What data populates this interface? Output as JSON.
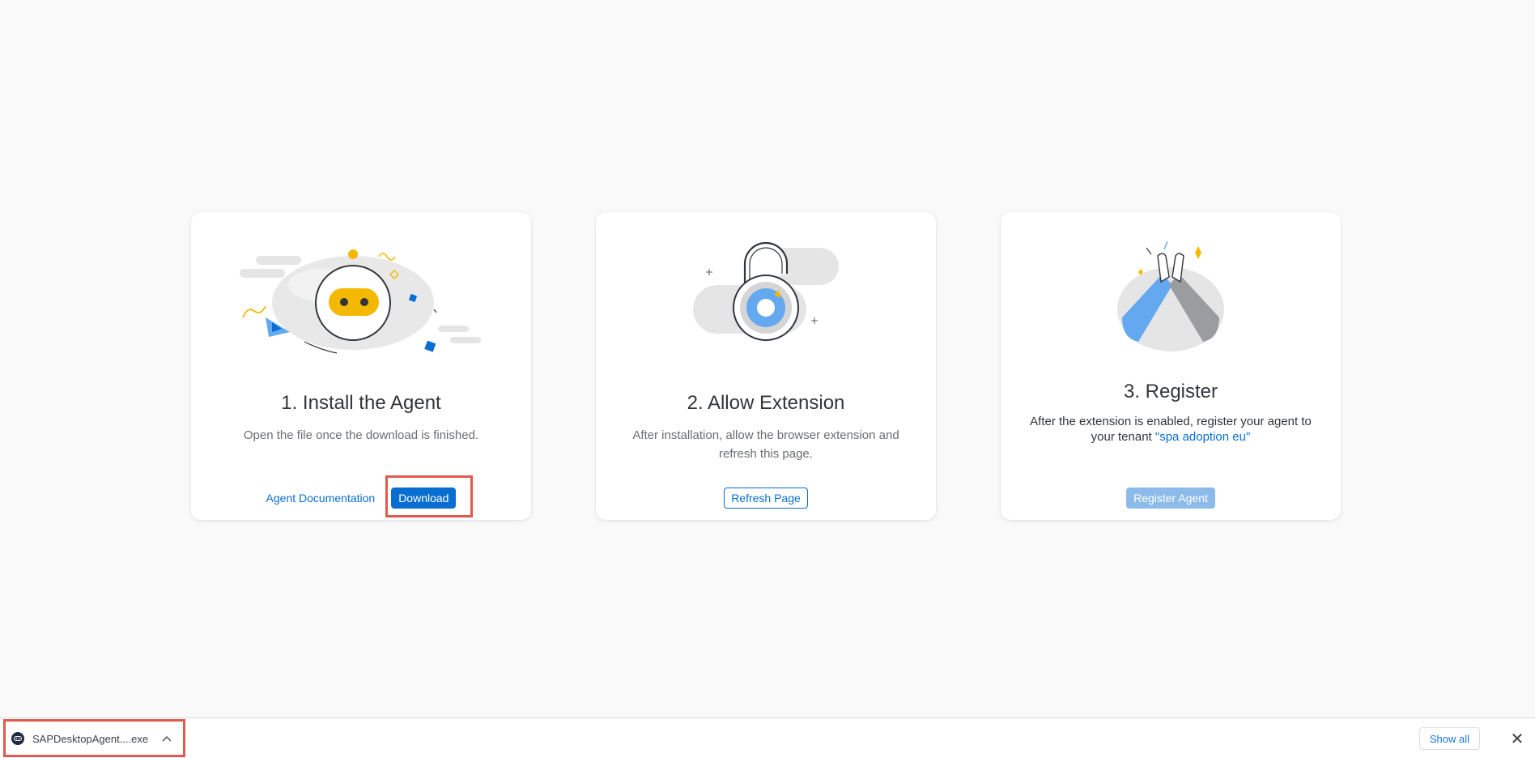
{
  "steps": [
    {
      "title": "1. Install the Agent",
      "description": "Open the file once the download is finished.",
      "link_label": "Agent Documentation",
      "primary_label": "Download"
    },
    {
      "title": "2. Allow Extension",
      "description": "After installation, allow the browser extension and refresh this page.",
      "secondary_label": "Refresh Page"
    },
    {
      "title": "3. Register",
      "description": "After the extension is enabled, register your agent to your tenant ",
      "tenant": "\"spa adoption eu\"",
      "disabled_label": "Register Agent"
    }
  ],
  "download_shelf": {
    "file_name": "SAPDesktopAgent....exe",
    "show_all_label": "Show all",
    "close_label": "✕"
  },
  "colors": {
    "accent": "#0a6ed1",
    "highlight": "#e05a4d",
    "illustration_yellow": "#f5b800",
    "illustration_blue": "#64a8f0"
  }
}
